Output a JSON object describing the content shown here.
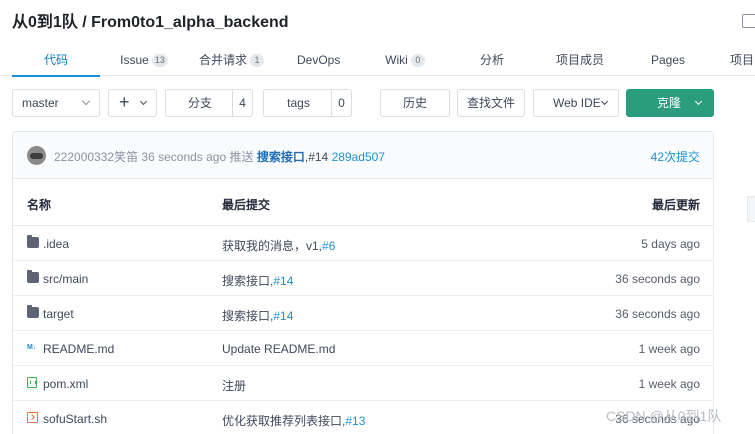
{
  "repo": {
    "title": "从0到1队 / From0to1_alpha_backend"
  },
  "tabs": [
    {
      "label": "代码",
      "count": null
    },
    {
      "label": "Issue",
      "count": "13"
    },
    {
      "label": "合并请求",
      "count": "1"
    },
    {
      "label": "DevOps",
      "count": null
    },
    {
      "label": "Wiki",
      "count": "0"
    },
    {
      "label": "分析",
      "count": null
    },
    {
      "label": "项目成员",
      "count": null
    },
    {
      "label": "Pages",
      "count": null
    },
    {
      "label": "项目",
      "count": null
    }
  ],
  "toolbar": {
    "branch_select": "master",
    "plus": "+",
    "branches_label": "分支",
    "branches_count": "4",
    "tags_label": "tags",
    "tags_count": "0",
    "history": "历史",
    "find_file": "查找文件",
    "web_ide": "Web IDE",
    "clone": "克隆"
  },
  "latest_commit": {
    "author": "222000332笑笛",
    "time": "36 seconds ago",
    "action": "推送",
    "message": "搜索接口",
    "ref": ",#14",
    "hash": "289ad507",
    "commit_count": "42次提交"
  },
  "table": {
    "headers": {
      "name": "名称",
      "last_commit": "最后提交",
      "last_update": "最后更新"
    },
    "rows": [
      {
        "icon": "folder-icon",
        "name": ".idea",
        "msg": "获取我的消息，v1,",
        "ref": "#6",
        "time": "5 days ago"
      },
      {
        "icon": "folder-icon",
        "name": "src/main",
        "msg": "搜索接口,",
        "ref": "#14",
        "time": "36 seconds ago"
      },
      {
        "icon": "folder-icon",
        "name": "target",
        "msg": "搜索接口,",
        "ref": "#14",
        "time": "36 seconds ago"
      },
      {
        "icon": "markdown-icon",
        "name": "README.md",
        "msg": "Update README.md",
        "ref": "",
        "time": "1 week ago"
      },
      {
        "icon": "xml-file-icon",
        "name": "pom.xml",
        "msg": "注册",
        "ref": "",
        "time": "1 week ago"
      },
      {
        "icon": "shell-script-icon",
        "name": "sofuStart.sh",
        "msg": "优化获取推荐列表接口,",
        "ref": "#13",
        "time": "36 seconds ago"
      }
    ]
  },
  "watermark": "CSDN @从0到1队",
  "icons": {
    "md_glyph": "M↓"
  },
  "colors": {
    "accent": "#1e8fd6",
    "clone_button": "#2a9d7e"
  }
}
